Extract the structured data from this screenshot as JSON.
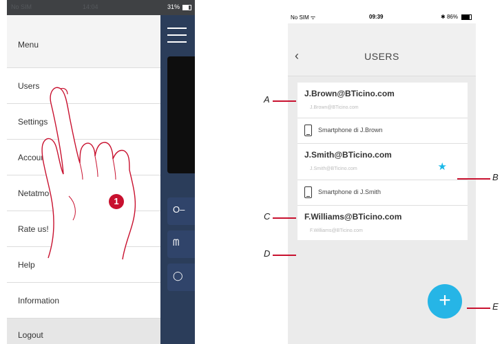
{
  "left_phone": {
    "status_bar": {
      "carrier": "No SIM",
      "time": "14:04",
      "battery": "31%"
    },
    "menu": {
      "title": "Menu",
      "items": [
        "Users",
        "Settings",
        "Account",
        "Netatmo cameras",
        "Rate us!",
        "Help",
        "Information"
      ],
      "logout": "Logout"
    },
    "step_badge": "1"
  },
  "right_phone": {
    "status_bar": {
      "carrier": "No SIM",
      "time": "09:39",
      "battery": "86%"
    },
    "header": {
      "title": "USERS"
    },
    "users": [
      {
        "email": "J.Brown@BTicino.com",
        "sub": "J.Brown@BTicino.com",
        "device": "Smartphone di J.Brown",
        "favorite": false
      },
      {
        "email": "J.Smith@BTicino.com",
        "sub": "J.Smith@BTicino.com",
        "device": "Smartphone di J.Smith",
        "favorite": true
      },
      {
        "email": "F.Williams@BTicino.com",
        "sub": "F.Williams@BTicino.com",
        "device": null,
        "favorite": false
      }
    ],
    "fab_label": "+"
  },
  "callouts": {
    "a": "A",
    "b": "B",
    "c": "C",
    "d": "D",
    "e": "E"
  },
  "colors": {
    "accent": "#26b5e6",
    "callout": "#c8102e",
    "app_bg": "#2b3d5a"
  }
}
